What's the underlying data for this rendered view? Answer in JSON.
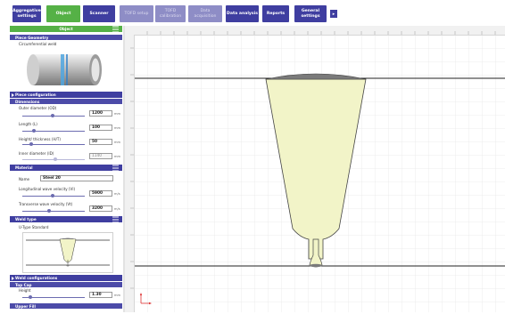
{
  "toolbar": {
    "buttons": [
      {
        "line1": "Aggregative",
        "line2": "settings",
        "state": "normal"
      },
      {
        "line1": "Object",
        "line2": "",
        "state": "active"
      },
      {
        "line1": "Scanner",
        "line2": "",
        "state": "normal"
      },
      {
        "line1": "TOFD setup",
        "line2": "",
        "state": "disabled"
      },
      {
        "line1": "TOFD",
        "line2": "calibration",
        "state": "disabled"
      },
      {
        "line1": "Data",
        "line2": "acquisition",
        "state": "disabled"
      },
      {
        "line1": "Data analysis",
        "line2": "",
        "state": "normal"
      },
      {
        "line1": "Reports",
        "line2": "",
        "state": "normal"
      },
      {
        "line1": "General",
        "line2": "settings",
        "state": "normal"
      }
    ],
    "more_glyph": "▸"
  },
  "left_panel": {
    "object_header": "Object",
    "piece_geometry": {
      "title": "Piece Geometry",
      "type": "Circumferential weld"
    },
    "piece_configuration": {
      "title": "Piece configuration"
    },
    "dimensions": {
      "title": "Dimensions",
      "fields": [
        {
          "label": "Outer diameter (OD)",
          "value": "1200",
          "unit": "mm",
          "slider": 0.45
        },
        {
          "label": "Length (L)",
          "value": "100",
          "unit": "mm",
          "slider": 0.15
        },
        {
          "label": "Height/ thickness (H/T)",
          "value": "50",
          "unit": "mm",
          "slider": 0.12
        },
        {
          "label": "Inner diameter (ID)",
          "value": "1140",
          "unit": "mm",
          "readonly": true
        }
      ]
    },
    "material": {
      "title": "Material",
      "name_label": "Name",
      "name_value": "Steel 20",
      "fields": [
        {
          "label": "Longitudinal wave velocity (Vl)",
          "value": "5900",
          "unit": "m/s",
          "slider": 0.45
        },
        {
          "label": "Transverse wave velocity (Vt)",
          "value": "3200",
          "unit": "m/s",
          "slider": 0.4
        }
      ]
    },
    "weld_type": {
      "title": "Weld type",
      "value": "U-Type Standard"
    },
    "weld_configurations": {
      "title": "Weld configurations"
    },
    "top_cap": {
      "title": "Top Cap",
      "fields": [
        {
          "label": "Height",
          "value": "1.30",
          "unit": "mm",
          "slider": 0.1
        }
      ]
    },
    "upper_fill": {
      "title": "Upper Fill"
    }
  },
  "colors": {
    "toolbar_button": "#3f3ea0",
    "active_button": "#55b146",
    "disabled_button": "#8e8dc6",
    "weld_fill": "#f2f4c8",
    "weld_cap": "#7a7a7a",
    "grid": "#d9d9d9"
  }
}
